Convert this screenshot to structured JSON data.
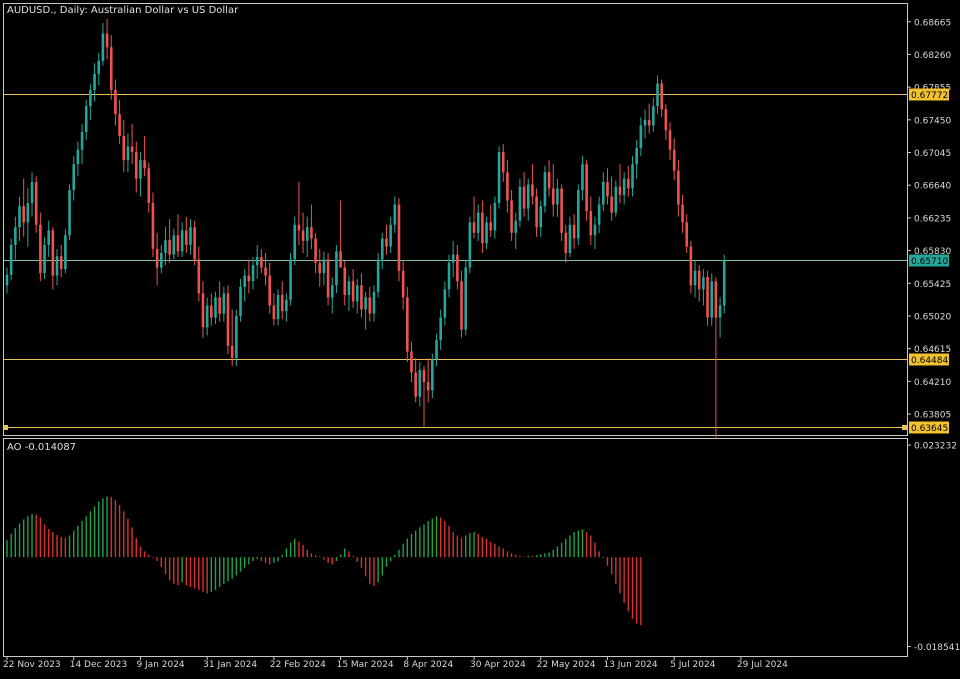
{
  "window": {
    "title": "AUDUSD., Daily:  Australian Dollar vs US Dollar"
  },
  "colors": {
    "background": "#000000",
    "frame": "#c8c8c8",
    "bull": "#26a69a",
    "bear": "#ef5350",
    "level_line": "#e8c15a",
    "current_line": "#7fbfa8",
    "ao_up": "#1fa34a",
    "ao_down": "#d9322e",
    "axis_text": "#d8d8d8",
    "label_yellow_bg": "#f2c230",
    "label_green_bg": "#26a69a"
  },
  "price_axis": {
    "ticks": [
      "0.68665",
      "0.68260",
      "0.67855",
      "0.67450",
      "0.67045",
      "0.66640",
      "0.66235",
      "0.65830",
      "0.65425",
      "0.65020",
      "0.64615",
      "0.64210",
      "0.63805"
    ],
    "tick_values": [
      0.68665,
      0.6826,
      0.67855,
      0.6745,
      0.67045,
      0.6664,
      0.66235,
      0.6583,
      0.65425,
      0.6502,
      0.64615,
      0.6421,
      0.63805
    ],
    "range": [
      0.63545,
      0.68885
    ]
  },
  "levels": [
    {
      "label": "0.67772",
      "value": 0.67772,
      "style": "yellow"
    },
    {
      "label": "0.64484",
      "value": 0.64484,
      "style": "yellow"
    },
    {
      "label": "0.63645",
      "value": 0.63645,
      "style": "yellow"
    }
  ],
  "current_price": {
    "label": "0.65710",
    "value": 0.6571
  },
  "ao": {
    "title": "AO -0.014087",
    "ticks": [
      "0.023232",
      "-0.018541"
    ],
    "tick_values": [
      0.023232,
      -0.018541
    ],
    "range": [
      -0.0205,
      0.0245
    ]
  },
  "date_axis": {
    "labels": [
      "22 Nov 2023",
      "14 Dec 2023",
      "9 Jan 2024",
      "31 Jan 2024",
      "22 Feb 2024",
      "15 Mar 2024",
      "8 Apr 2024",
      "30 Apr 2024",
      "22 May 2024",
      "13 Jun 2024",
      "5 Jul 2024",
      "29 Jul 2024"
    ],
    "bar_index": [
      0,
      16,
      32,
      48,
      64,
      80,
      96,
      112,
      128,
      144,
      160,
      176
    ]
  },
  "candles": [
    {
      "o": 0.654,
      "h": 0.6562,
      "l": 0.653,
      "c": 0.6553
    },
    {
      "o": 0.6553,
      "h": 0.6598,
      "l": 0.6546,
      "c": 0.659
    },
    {
      "o": 0.659,
      "h": 0.6625,
      "l": 0.6572,
      "c": 0.6612
    },
    {
      "o": 0.6612,
      "h": 0.665,
      "l": 0.6595,
      "c": 0.6638
    },
    {
      "o": 0.6638,
      "h": 0.6672,
      "l": 0.66,
      "c": 0.6618
    },
    {
      "o": 0.6618,
      "h": 0.666,
      "l": 0.6588,
      "c": 0.6642
    },
    {
      "o": 0.6642,
      "h": 0.668,
      "l": 0.6625,
      "c": 0.6668
    },
    {
      "o": 0.6668,
      "h": 0.6675,
      "l": 0.6605,
      "c": 0.6615
    },
    {
      "o": 0.6615,
      "h": 0.663,
      "l": 0.6545,
      "c": 0.6555
    },
    {
      "o": 0.6555,
      "h": 0.66,
      "l": 0.6548,
      "c": 0.659
    },
    {
      "o": 0.659,
      "h": 0.662,
      "l": 0.6575,
      "c": 0.6608
    },
    {
      "o": 0.6608,
      "h": 0.6612,
      "l": 0.6535,
      "c": 0.6552
    },
    {
      "o": 0.6552,
      "h": 0.6585,
      "l": 0.654,
      "c": 0.6576
    },
    {
      "o": 0.6576,
      "h": 0.659,
      "l": 0.655,
      "c": 0.656
    },
    {
      "o": 0.656,
      "h": 0.661,
      "l": 0.6555,
      "c": 0.6602
    },
    {
      "o": 0.6602,
      "h": 0.6665,
      "l": 0.6596,
      "c": 0.6658
    },
    {
      "o": 0.6658,
      "h": 0.67,
      "l": 0.6645,
      "c": 0.669
    },
    {
      "o": 0.669,
      "h": 0.6718,
      "l": 0.6675,
      "c": 0.6708
    },
    {
      "o": 0.6708,
      "h": 0.674,
      "l": 0.669,
      "c": 0.673
    },
    {
      "o": 0.673,
      "h": 0.677,
      "l": 0.672,
      "c": 0.6762
    },
    {
      "o": 0.6762,
      "h": 0.679,
      "l": 0.6745,
      "c": 0.6782
    },
    {
      "o": 0.6782,
      "h": 0.6815,
      "l": 0.6768,
      "c": 0.6802
    },
    {
      "o": 0.6802,
      "h": 0.6828,
      "l": 0.6788,
      "c": 0.6818
    },
    {
      "o": 0.6818,
      "h": 0.6865,
      "l": 0.6812,
      "c": 0.6852
    },
    {
      "o": 0.6852,
      "h": 0.687,
      "l": 0.682,
      "c": 0.6835
    },
    {
      "o": 0.6835,
      "h": 0.685,
      "l": 0.677,
      "c": 0.6782
    },
    {
      "o": 0.6782,
      "h": 0.6795,
      "l": 0.6738,
      "c": 0.6752
    },
    {
      "o": 0.6752,
      "h": 0.677,
      "l": 0.6715,
      "c": 0.6725
    },
    {
      "o": 0.6725,
      "h": 0.6745,
      "l": 0.668,
      "c": 0.6695
    },
    {
      "o": 0.6695,
      "h": 0.6728,
      "l": 0.668,
      "c": 0.6712
    },
    {
      "o": 0.6712,
      "h": 0.674,
      "l": 0.669,
      "c": 0.6705
    },
    {
      "o": 0.6705,
      "h": 0.6718,
      "l": 0.6655,
      "c": 0.6672
    },
    {
      "o": 0.6672,
      "h": 0.6705,
      "l": 0.665,
      "c": 0.6695
    },
    {
      "o": 0.6695,
      "h": 0.6725,
      "l": 0.6675,
      "c": 0.6685
    },
    {
      "o": 0.6685,
      "h": 0.6692,
      "l": 0.663,
      "c": 0.6642
    },
    {
      "o": 0.6642,
      "h": 0.6655,
      "l": 0.6575,
      "c": 0.6585
    },
    {
      "o": 0.6585,
      "h": 0.6605,
      "l": 0.654,
      "c": 0.6562
    },
    {
      "o": 0.6562,
      "h": 0.659,
      "l": 0.6555,
      "c": 0.658
    },
    {
      "o": 0.658,
      "h": 0.6612,
      "l": 0.6565,
      "c": 0.6596
    },
    {
      "o": 0.6596,
      "h": 0.6622,
      "l": 0.6568,
      "c": 0.6578
    },
    {
      "o": 0.6578,
      "h": 0.661,
      "l": 0.6572,
      "c": 0.6602
    },
    {
      "o": 0.6602,
      "h": 0.6628,
      "l": 0.6575,
      "c": 0.6582
    },
    {
      "o": 0.6582,
      "h": 0.6618,
      "l": 0.6575,
      "c": 0.6608
    },
    {
      "o": 0.6608,
      "h": 0.6625,
      "l": 0.658,
      "c": 0.659
    },
    {
      "o": 0.659,
      "h": 0.6622,
      "l": 0.6578,
      "c": 0.6612
    },
    {
      "o": 0.6612,
      "h": 0.662,
      "l": 0.6565,
      "c": 0.6572
    },
    {
      "o": 0.6572,
      "h": 0.6588,
      "l": 0.652,
      "c": 0.653
    },
    {
      "o": 0.653,
      "h": 0.6545,
      "l": 0.6475,
      "c": 0.6488
    },
    {
      "o": 0.6488,
      "h": 0.6525,
      "l": 0.6478,
      "c": 0.6515
    },
    {
      "o": 0.6515,
      "h": 0.653,
      "l": 0.649,
      "c": 0.65
    },
    {
      "o": 0.65,
      "h": 0.6532,
      "l": 0.6492,
      "c": 0.6525
    },
    {
      "o": 0.6525,
      "h": 0.6545,
      "l": 0.6495,
      "c": 0.6505
    },
    {
      "o": 0.6505,
      "h": 0.6538,
      "l": 0.6495,
      "c": 0.653
    },
    {
      "o": 0.653,
      "h": 0.654,
      "l": 0.6455,
      "c": 0.6465
    },
    {
      "o": 0.6465,
      "h": 0.651,
      "l": 0.644,
      "c": 0.645
    },
    {
      "o": 0.645,
      "h": 0.651,
      "l": 0.644,
      "c": 0.6502
    },
    {
      "o": 0.6502,
      "h": 0.6548,
      "l": 0.6495,
      "c": 0.6538
    },
    {
      "o": 0.6538,
      "h": 0.656,
      "l": 0.652,
      "c": 0.6552
    },
    {
      "o": 0.6552,
      "h": 0.6572,
      "l": 0.653,
      "c": 0.6545
    },
    {
      "o": 0.6545,
      "h": 0.6575,
      "l": 0.6535,
      "c": 0.6565
    },
    {
      "o": 0.6565,
      "h": 0.659,
      "l": 0.6548,
      "c": 0.6575
    },
    {
      "o": 0.6575,
      "h": 0.6585,
      "l": 0.6555,
      "c": 0.6562
    },
    {
      "o": 0.6562,
      "h": 0.658,
      "l": 0.654,
      "c": 0.6552
    },
    {
      "o": 0.6552,
      "h": 0.6568,
      "l": 0.6505,
      "c": 0.6515
    },
    {
      "o": 0.6515,
      "h": 0.653,
      "l": 0.649,
      "c": 0.6498
    },
    {
      "o": 0.6498,
      "h": 0.6535,
      "l": 0.649,
      "c": 0.6528
    },
    {
      "o": 0.6528,
      "h": 0.6545,
      "l": 0.6498,
      "c": 0.6508
    },
    {
      "o": 0.6508,
      "h": 0.653,
      "l": 0.6495,
      "c": 0.6522
    },
    {
      "o": 0.6522,
      "h": 0.658,
      "l": 0.6515,
      "c": 0.6572
    },
    {
      "o": 0.6572,
      "h": 0.6625,
      "l": 0.6565,
      "c": 0.6615
    },
    {
      "o": 0.6615,
      "h": 0.6668,
      "l": 0.659,
      "c": 0.6608
    },
    {
      "o": 0.6608,
      "h": 0.663,
      "l": 0.658,
      "c": 0.6595
    },
    {
      "o": 0.6595,
      "h": 0.6625,
      "l": 0.6575,
      "c": 0.6612
    },
    {
      "o": 0.6612,
      "h": 0.664,
      "l": 0.6585,
      "c": 0.6598
    },
    {
      "o": 0.6598,
      "h": 0.6605,
      "l": 0.6555,
      "c": 0.6568
    },
    {
      "o": 0.6568,
      "h": 0.6585,
      "l": 0.6538,
      "c": 0.6555
    },
    {
      "o": 0.6555,
      "h": 0.6582,
      "l": 0.654,
      "c": 0.6572
    },
    {
      "o": 0.6572,
      "h": 0.658,
      "l": 0.6515,
      "c": 0.6525
    },
    {
      "o": 0.6525,
      "h": 0.655,
      "l": 0.6505,
      "c": 0.654
    },
    {
      "o": 0.654,
      "h": 0.659,
      "l": 0.653,
      "c": 0.6582
    },
    {
      "o": 0.6582,
      "h": 0.6645,
      "l": 0.6575,
      "c": 0.6562
    },
    {
      "o": 0.6562,
      "h": 0.657,
      "l": 0.6515,
      "c": 0.6528
    },
    {
      "o": 0.6528,
      "h": 0.6552,
      "l": 0.6508,
      "c": 0.6545
    },
    {
      "o": 0.6545,
      "h": 0.656,
      "l": 0.6512,
      "c": 0.652
    },
    {
      "o": 0.652,
      "h": 0.6548,
      "l": 0.6505,
      "c": 0.654
    },
    {
      "o": 0.654,
      "h": 0.6555,
      "l": 0.65,
      "c": 0.651
    },
    {
      "o": 0.651,
      "h": 0.6532,
      "l": 0.6485,
      "c": 0.6525
    },
    {
      "o": 0.6525,
      "h": 0.6538,
      "l": 0.6495,
      "c": 0.6505
    },
    {
      "o": 0.6505,
      "h": 0.654,
      "l": 0.6495,
      "c": 0.6532
    },
    {
      "o": 0.6532,
      "h": 0.658,
      "l": 0.6525,
      "c": 0.6572
    },
    {
      "o": 0.6572,
      "h": 0.6605,
      "l": 0.656,
      "c": 0.6598
    },
    {
      "o": 0.6598,
      "h": 0.6615,
      "l": 0.6578,
      "c": 0.6588
    },
    {
      "o": 0.6588,
      "h": 0.6625,
      "l": 0.658,
      "c": 0.6615
    },
    {
      "o": 0.6615,
      "h": 0.665,
      "l": 0.6605,
      "c": 0.664
    },
    {
      "o": 0.664,
      "h": 0.6648,
      "l": 0.6545,
      "c": 0.6558
    },
    {
      "o": 0.6558,
      "h": 0.657,
      "l": 0.651,
      "c": 0.6525
    },
    {
      "o": 0.6525,
      "h": 0.6538,
      "l": 0.6445,
      "c": 0.6458
    },
    {
      "o": 0.6458,
      "h": 0.647,
      "l": 0.642,
      "c": 0.6432
    },
    {
      "o": 0.6432,
      "h": 0.645,
      "l": 0.6395,
      "c": 0.6402
    },
    {
      "o": 0.6402,
      "h": 0.6445,
      "l": 0.639,
      "c": 0.6435
    },
    {
      "o": 0.6435,
      "h": 0.644,
      "l": 0.6365,
      "c": 0.642
    },
    {
      "o": 0.642,
      "h": 0.645,
      "l": 0.6395,
      "c": 0.641
    },
    {
      "o": 0.641,
      "h": 0.6455,
      "l": 0.64,
      "c": 0.6448
    },
    {
      "o": 0.6448,
      "h": 0.648,
      "l": 0.644,
      "c": 0.6472
    },
    {
      "o": 0.6472,
      "h": 0.651,
      "l": 0.646,
      "c": 0.65
    },
    {
      "o": 0.65,
      "h": 0.6545,
      "l": 0.649,
      "c": 0.6535
    },
    {
      "o": 0.6535,
      "h": 0.6578,
      "l": 0.6525,
      "c": 0.6568
    },
    {
      "o": 0.6568,
      "h": 0.6595,
      "l": 0.655,
      "c": 0.6578
    },
    {
      "o": 0.6578,
      "h": 0.659,
      "l": 0.6535,
      "c": 0.6545
    },
    {
      "o": 0.6545,
      "h": 0.6558,
      "l": 0.6475,
      "c": 0.6485
    },
    {
      "o": 0.6485,
      "h": 0.657,
      "l": 0.6478,
      "c": 0.6562
    },
    {
      "o": 0.6562,
      "h": 0.6625,
      "l": 0.6555,
      "c": 0.6618
    },
    {
      "o": 0.6618,
      "h": 0.665,
      "l": 0.6598,
      "c": 0.6605
    },
    {
      "o": 0.6605,
      "h": 0.664,
      "l": 0.6595,
      "c": 0.663
    },
    {
      "o": 0.663,
      "h": 0.6645,
      "l": 0.658,
      "c": 0.6592
    },
    {
      "o": 0.6592,
      "h": 0.6625,
      "l": 0.6585,
      "c": 0.6618
    },
    {
      "o": 0.6618,
      "h": 0.664,
      "l": 0.66,
      "c": 0.6608
    },
    {
      "o": 0.6608,
      "h": 0.665,
      "l": 0.6598,
      "c": 0.6642
    },
    {
      "o": 0.6642,
      "h": 0.6712,
      "l": 0.6635,
      "c": 0.6705
    },
    {
      "o": 0.6705,
      "h": 0.6715,
      "l": 0.6668,
      "c": 0.668
    },
    {
      "o": 0.668,
      "h": 0.6695,
      "l": 0.663,
      "c": 0.6645
    },
    {
      "o": 0.6645,
      "h": 0.6658,
      "l": 0.6595,
      "c": 0.6605
    },
    {
      "o": 0.6605,
      "h": 0.663,
      "l": 0.6585,
      "c": 0.662
    },
    {
      "o": 0.662,
      "h": 0.6672,
      "l": 0.6612,
      "c": 0.6662
    },
    {
      "o": 0.6662,
      "h": 0.668,
      "l": 0.6625,
      "c": 0.6635
    },
    {
      "o": 0.6635,
      "h": 0.6672,
      "l": 0.662,
      "c": 0.6665
    },
    {
      "o": 0.6665,
      "h": 0.669,
      "l": 0.664,
      "c": 0.665
    },
    {
      "o": 0.665,
      "h": 0.666,
      "l": 0.66,
      "c": 0.6612
    },
    {
      "o": 0.6612,
      "h": 0.6645,
      "l": 0.66,
      "c": 0.6638
    },
    {
      "o": 0.6638,
      "h": 0.6688,
      "l": 0.663,
      "c": 0.668
    },
    {
      "o": 0.668,
      "h": 0.6695,
      "l": 0.665,
      "c": 0.666
    },
    {
      "o": 0.666,
      "h": 0.669,
      "l": 0.6625,
      "c": 0.664
    },
    {
      "o": 0.664,
      "h": 0.6672,
      "l": 0.6625,
      "c": 0.666
    },
    {
      "o": 0.666,
      "h": 0.6665,
      "l": 0.6595,
      "c": 0.6605
    },
    {
      "o": 0.6605,
      "h": 0.6615,
      "l": 0.6568,
      "c": 0.658
    },
    {
      "o": 0.658,
      "h": 0.6625,
      "l": 0.6575,
      "c": 0.6615
    },
    {
      "o": 0.6615,
      "h": 0.6628,
      "l": 0.6585,
      "c": 0.6598
    },
    {
      "o": 0.6598,
      "h": 0.6665,
      "l": 0.659,
      "c": 0.6658
    },
    {
      "o": 0.6658,
      "h": 0.67,
      "l": 0.6645,
      "c": 0.669
    },
    {
      "o": 0.669,
      "h": 0.6695,
      "l": 0.662,
      "c": 0.6632
    },
    {
      "o": 0.6632,
      "h": 0.665,
      "l": 0.659,
      "c": 0.6602
    },
    {
      "o": 0.6602,
      "h": 0.6625,
      "l": 0.6585,
      "c": 0.6615
    },
    {
      "o": 0.6615,
      "h": 0.665,
      "l": 0.6605,
      "c": 0.664
    },
    {
      "o": 0.664,
      "h": 0.668,
      "l": 0.6632,
      "c": 0.6668
    },
    {
      "o": 0.6668,
      "h": 0.6685,
      "l": 0.664,
      "c": 0.665
    },
    {
      "o": 0.665,
      "h": 0.6675,
      "l": 0.662,
      "c": 0.663
    },
    {
      "o": 0.663,
      "h": 0.667,
      "l": 0.6625,
      "c": 0.6662
    },
    {
      "o": 0.6662,
      "h": 0.669,
      "l": 0.6642,
      "c": 0.6652
    },
    {
      "o": 0.6652,
      "h": 0.668,
      "l": 0.664,
      "c": 0.6672
    },
    {
      "o": 0.6672,
      "h": 0.6688,
      "l": 0.665,
      "c": 0.666
    },
    {
      "o": 0.666,
      "h": 0.67,
      "l": 0.665,
      "c": 0.669
    },
    {
      "o": 0.669,
      "h": 0.672,
      "l": 0.6672,
      "c": 0.671
    },
    {
      "o": 0.671,
      "h": 0.6748,
      "l": 0.67,
      "c": 0.6738
    },
    {
      "o": 0.6738,
      "h": 0.6758,
      "l": 0.6722,
      "c": 0.6745
    },
    {
      "o": 0.6745,
      "h": 0.6765,
      "l": 0.6728,
      "c": 0.6738
    },
    {
      "o": 0.6738,
      "h": 0.6772,
      "l": 0.673,
      "c": 0.6762
    },
    {
      "o": 0.6762,
      "h": 0.68,
      "l": 0.6752,
      "c": 0.679
    },
    {
      "o": 0.679,
      "h": 0.6795,
      "l": 0.6748,
      "c": 0.6758
    },
    {
      "o": 0.6758,
      "h": 0.6765,
      "l": 0.672,
      "c": 0.6732
    },
    {
      "o": 0.6732,
      "h": 0.6742,
      "l": 0.6695,
      "c": 0.6708
    },
    {
      "o": 0.6708,
      "h": 0.6722,
      "l": 0.667,
      "c": 0.6682
    },
    {
      "o": 0.6682,
      "h": 0.6695,
      "l": 0.6625,
      "c": 0.664
    },
    {
      "o": 0.664,
      "h": 0.6652,
      "l": 0.6605,
      "c": 0.6618
    },
    {
      "o": 0.6618,
      "h": 0.6628,
      "l": 0.658,
      "c": 0.6588
    },
    {
      "o": 0.6588,
      "h": 0.6595,
      "l": 0.653,
      "c": 0.654
    },
    {
      "o": 0.654,
      "h": 0.657,
      "l": 0.6525,
      "c": 0.6558
    },
    {
      "o": 0.6558,
      "h": 0.6565,
      "l": 0.652,
      "c": 0.6535
    },
    {
      "o": 0.6535,
      "h": 0.656,
      "l": 0.6515,
      "c": 0.655
    },
    {
      "o": 0.655,
      "h": 0.6558,
      "l": 0.649,
      "c": 0.65
    },
    {
      "o": 0.65,
      "h": 0.6555,
      "l": 0.649,
      "c": 0.6545
    },
    {
      "o": 0.6545,
      "h": 0.655,
      "l": 0.635,
      "c": 0.65
    },
    {
      "o": 0.65,
      "h": 0.6525,
      "l": 0.6475,
      "c": 0.6515
    },
    {
      "o": 0.6515,
      "h": 0.6578,
      "l": 0.6505,
      "c": 0.6571
    }
  ],
  "ao_values": [
    0.0035,
    0.0048,
    0.006,
    0.007,
    0.0078,
    0.0085,
    0.009,
    0.0088,
    0.0082,
    0.0068,
    0.0058,
    0.0052,
    0.0046,
    0.0042,
    0.004,
    0.0045,
    0.0055,
    0.0065,
    0.0075,
    0.0085,
    0.0095,
    0.0105,
    0.0115,
    0.0122,
    0.0126,
    0.0125,
    0.0118,
    0.0108,
    0.0095,
    0.008,
    0.0062,
    0.004,
    0.0022,
    0.0012,
    0.0005,
    -0.0002,
    -0.0008,
    -0.002,
    -0.0035,
    -0.0048,
    -0.0055,
    -0.0058,
    -0.0052,
    -0.0058,
    -0.0062,
    -0.0065,
    -0.0068,
    -0.0072,
    -0.0075,
    -0.0072,
    -0.0068,
    -0.0062,
    -0.0055,
    -0.005,
    -0.0045,
    -0.0038,
    -0.003,
    -0.0022,
    -0.0015,
    -0.0008,
    -0.0004,
    -0.0008,
    -0.0012,
    -0.0015,
    -0.0012,
    -0.0008,
    0.0005,
    0.0018,
    0.003,
    0.0038,
    0.0032,
    0.0025,
    0.0015,
    0.0008,
    0.0004,
    0.0002,
    -0.0005,
    -0.0012,
    -0.0015,
    -0.0008,
    0.0005,
    0.0018,
    0.0012,
    0.0002,
    -0.001,
    -0.0022,
    -0.004,
    -0.0055,
    -0.006,
    -0.0052,
    -0.0038,
    -0.002,
    -0.0008,
    0.0005,
    0.0015,
    0.0028,
    0.0038,
    0.0048,
    0.0055,
    0.0062,
    0.0068,
    0.0075,
    0.008,
    0.0085,
    0.0082,
    0.0075,
    0.0065,
    0.0052,
    0.0045,
    0.004,
    0.0045,
    0.005,
    0.0052,
    0.0048,
    0.0042,
    0.0038,
    0.0032,
    0.0028,
    0.0022,
    0.0018,
    0.0012,
    0.0008,
    0.0005,
    0.0002,
    0.0001,
    0.0003,
    0.0002,
    0.0004,
    0.0006,
    0.0008,
    0.001,
    0.0015,
    0.0022,
    0.003,
    0.0038,
    0.0045,
    0.0052,
    0.0055,
    0.0058,
    0.0052,
    0.0045,
    0.003,
    0.0012,
    -0.0002,
    -0.0018,
    -0.0035,
    -0.0055,
    -0.0075,
    -0.0095,
    -0.0112,
    -0.0128,
    -0.0138,
    -0.0141
  ]
}
